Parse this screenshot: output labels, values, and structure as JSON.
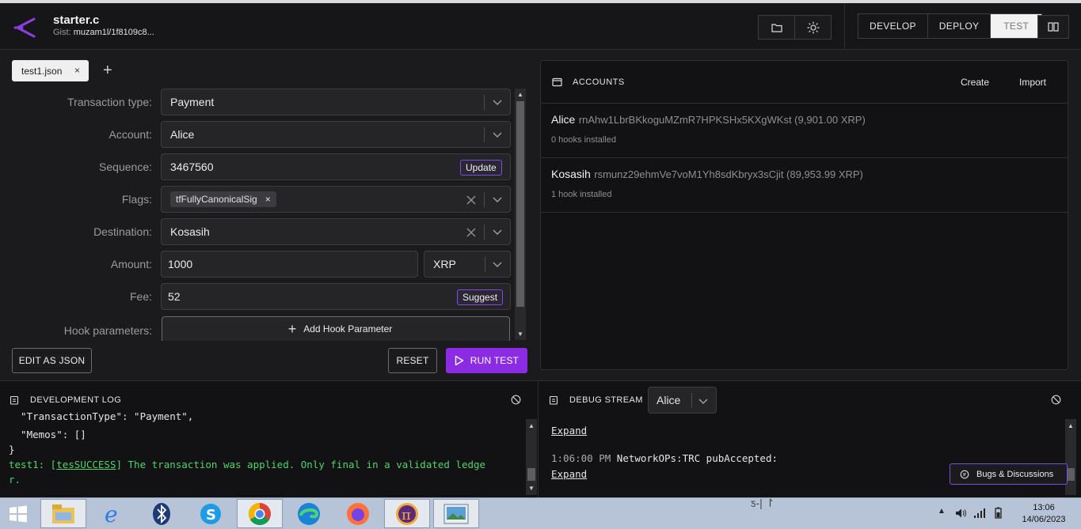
{
  "header": {
    "title": "starter.c",
    "gist_label": "Gist:",
    "gist_value": "muzam1l/1f8109c8...",
    "modes": [
      "DEVELOP",
      "DEPLOY",
      "TEST"
    ],
    "active_mode": "TEST"
  },
  "tabs": {
    "file": "test1.json",
    "close": "×",
    "add": "+"
  },
  "form": {
    "transaction_type_label": "Transaction type:",
    "transaction_type_value": "Payment",
    "account_label": "Account:",
    "account_value": "Alice",
    "sequence_label": "Sequence:",
    "sequence_value": "3467560",
    "sequence_button": "Update",
    "flags_label": "Flags:",
    "flags_chip": "tfFullyCanonicalSig",
    "destination_label": "Destination:",
    "destination_value": "Kosasih",
    "amount_label": "Amount:",
    "amount_value": "1000",
    "currency_value": "XRP",
    "fee_label": "Fee:",
    "fee_value": "52",
    "fee_button": "Suggest",
    "hook_params_label": "Hook parameters:",
    "hook_params_button": "Add Hook Parameter"
  },
  "actions": {
    "edit_json": "EDIT AS JSON",
    "reset": "RESET",
    "run": "RUN TEST"
  },
  "accounts": {
    "title": "ACCOUNTS",
    "create": "Create",
    "import": "Import",
    "items": [
      {
        "name": "Alice",
        "address": "rnAhw1LbrBKkoguMZmR7HPKSHx5KXgWKst (9,901.00 XRP)",
        "hooks": "0 hooks installed"
      },
      {
        "name": "Kosasih",
        "address": "rsmunz29ehmVe7voM1Yh8sdKbryx3sCjit (89,953.99 XRP)",
        "hooks": "1 hook installed"
      }
    ]
  },
  "dev_log": {
    "title": "DEVELOPMENT LOG",
    "line1": "  \"TransactionType\": \"Payment\",",
    "line2": "  \"Memos\": []",
    "line3": "}",
    "line4_prefix": "test1: [",
    "line4_link": "tesSUCCESS",
    "line4_suffix": "] The transaction was applied. Only final in a validated ledge",
    "line5": "r."
  },
  "debug_stream": {
    "title": "DEBUG STREAM",
    "account": "Alice",
    "expand1": "Expand",
    "time": "1:06:00 PM",
    "message": "NetworkOPs:TRC pubAccepted:",
    "expand2": "Expand",
    "bugs_button": "Bugs & Discussions"
  },
  "taskbar": {
    "time": "13:06",
    "date": "14/06/2023"
  }
}
